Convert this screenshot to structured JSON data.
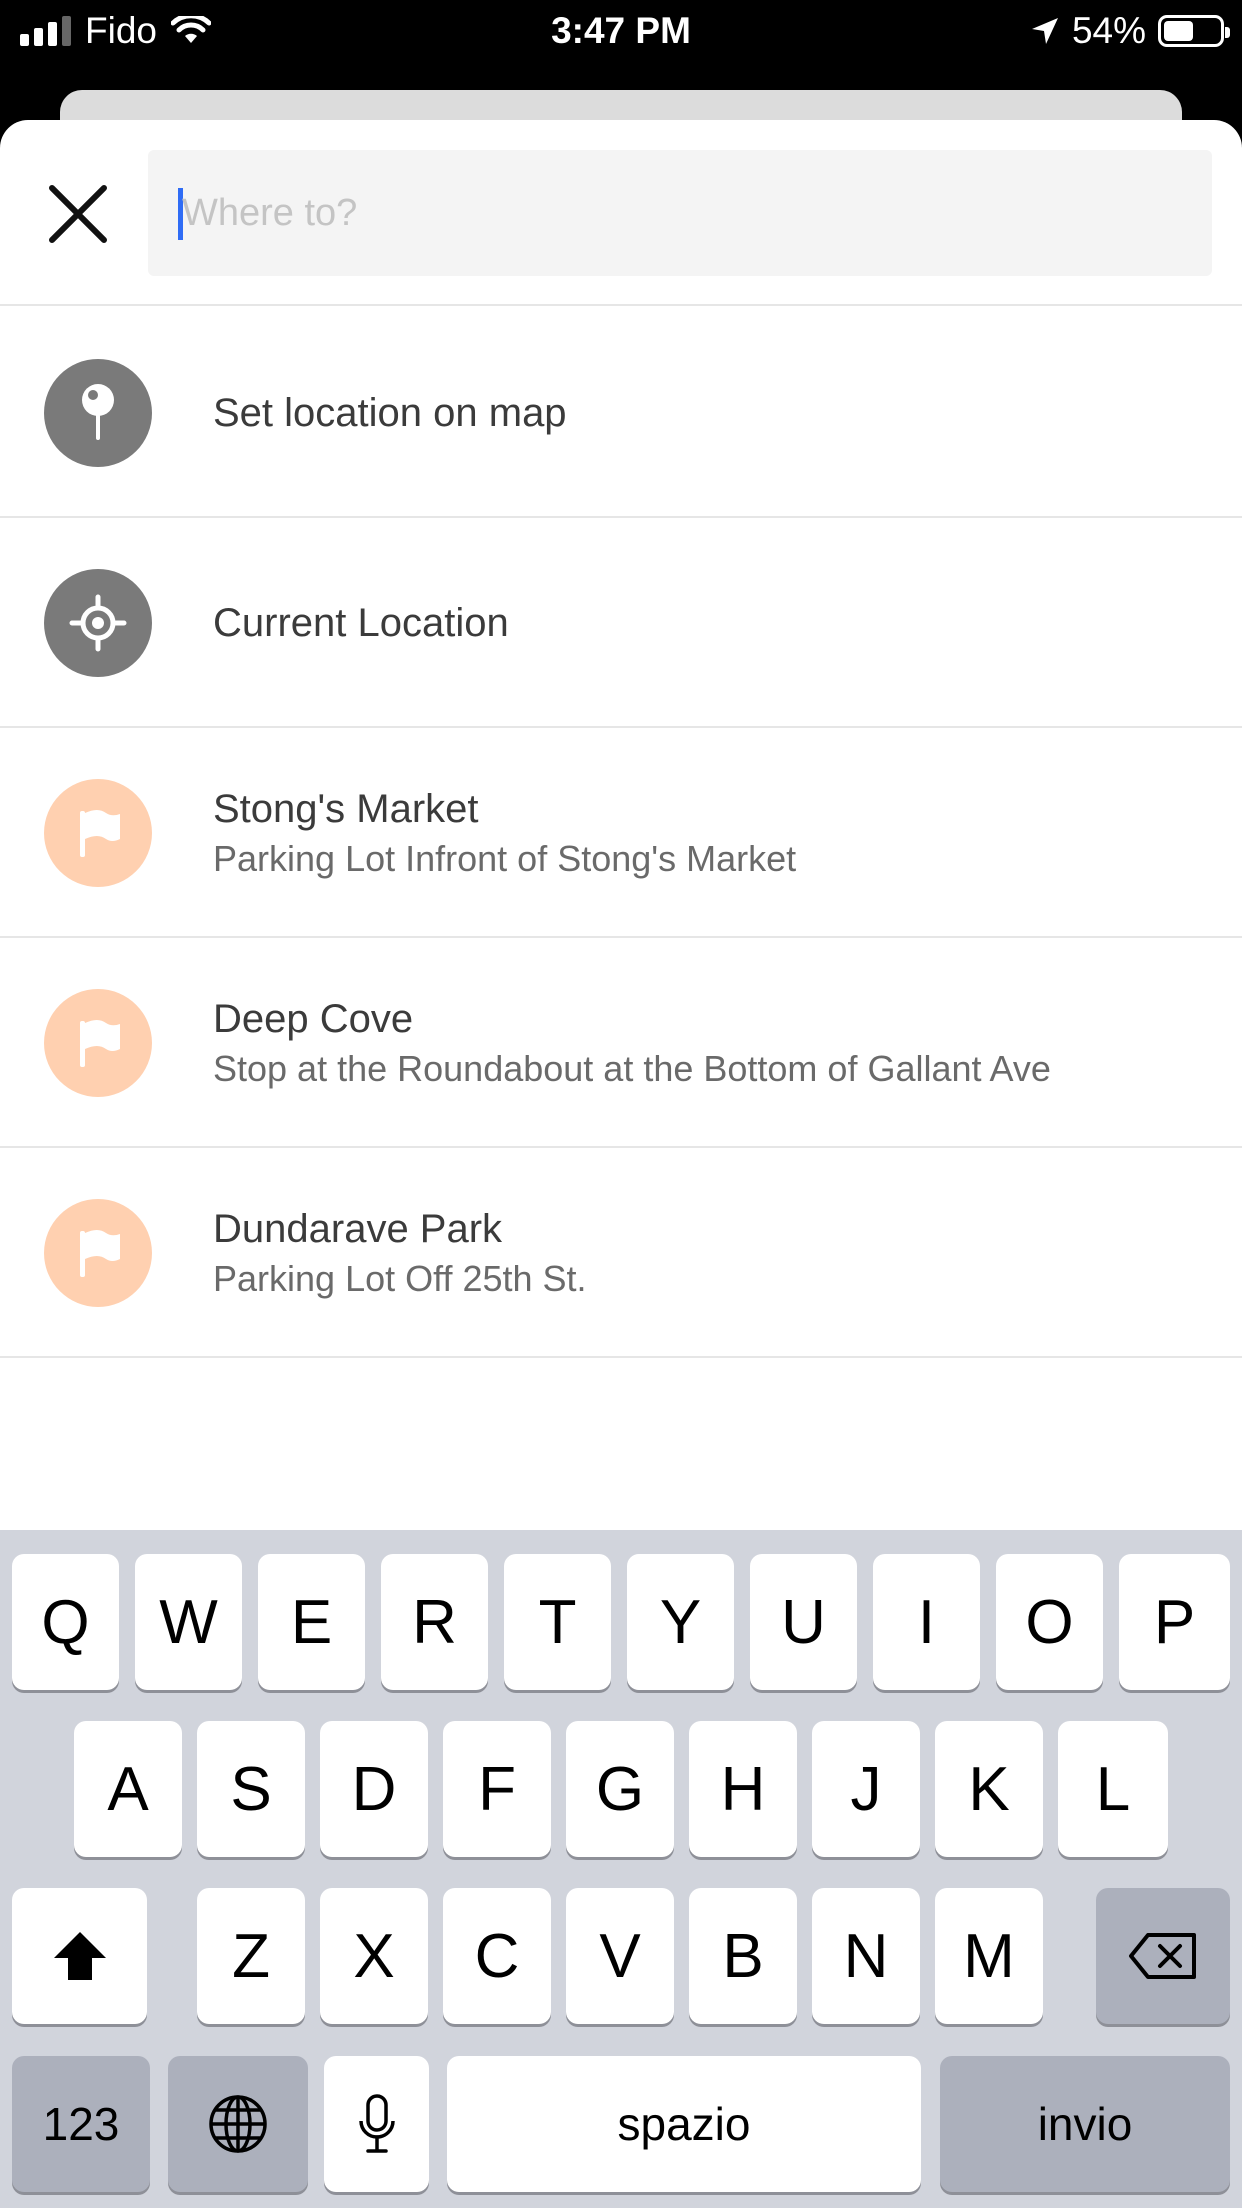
{
  "status_bar": {
    "carrier": "Fido",
    "time": "3:47 PM",
    "battery": "54%",
    "battery_level": 0.54
  },
  "search": {
    "placeholder": "Where to?",
    "value": ""
  },
  "items": [
    {
      "title": "Set location on map",
      "subtitle": "",
      "icon": "map-pin-icon"
    },
    {
      "title": "Current Location",
      "subtitle": "",
      "icon": "crosshair-icon"
    },
    {
      "title": "Stong's Market",
      "subtitle": "Parking Lot Infront of Stong's Market",
      "icon": "flag-icon"
    },
    {
      "title": "Deep Cove",
      "subtitle": "Stop at the Roundabout at the Bottom of Gallant Ave",
      "icon": "flag-icon"
    },
    {
      "title": "Dundarave Park",
      "subtitle": "Parking Lot Off 25th St.",
      "icon": "flag-icon"
    }
  ],
  "keyboard": {
    "row1": [
      "Q",
      "W",
      "E",
      "R",
      "T",
      "Y",
      "U",
      "I",
      "O",
      "P"
    ],
    "row2": [
      "A",
      "S",
      "D",
      "F",
      "G",
      "H",
      "J",
      "K",
      "L"
    ],
    "row3": [
      "Z",
      "X",
      "C",
      "V",
      "B",
      "N",
      "M"
    ],
    "numbers": "123",
    "space": "spazio",
    "return": "invio"
  },
  "colors": {
    "icon_gray": "#7a7a7a",
    "icon_peach": "#ffd0b0",
    "caret": "#2f6cf5",
    "keyboard_bg": "#d1d4dc"
  }
}
